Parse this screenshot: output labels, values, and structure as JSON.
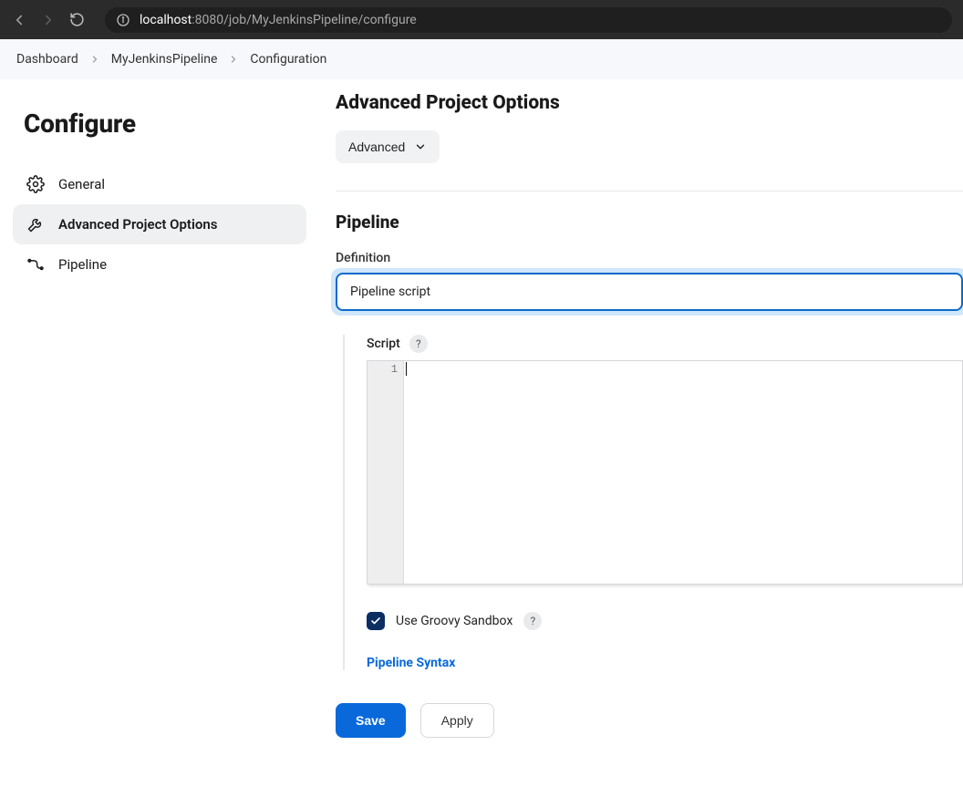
{
  "browser": {
    "url_host": "localhost",
    "url_port_path": ":8080/job/MyJenkinsPipeline/configure"
  },
  "breadcrumb": {
    "items": [
      "Dashboard",
      "MyJenkinsPipeline",
      "Configuration"
    ]
  },
  "sidebar": {
    "title": "Configure",
    "items": [
      {
        "label": "General"
      },
      {
        "label": "Advanced Project Options"
      },
      {
        "label": "Pipeline"
      }
    ]
  },
  "sections": {
    "advanced_title": "Advanced Project Options",
    "advanced_button": "Advanced",
    "pipeline_title": "Pipeline",
    "definition_label": "Definition",
    "definition_value": "Pipeline script",
    "script_label": "Script",
    "help_glyph": "?",
    "line_number": "1",
    "sandbox_label": "Use Groovy Sandbox",
    "syntax_link": "Pipeline Syntax"
  },
  "buttons": {
    "save": "Save",
    "apply": "Apply"
  }
}
